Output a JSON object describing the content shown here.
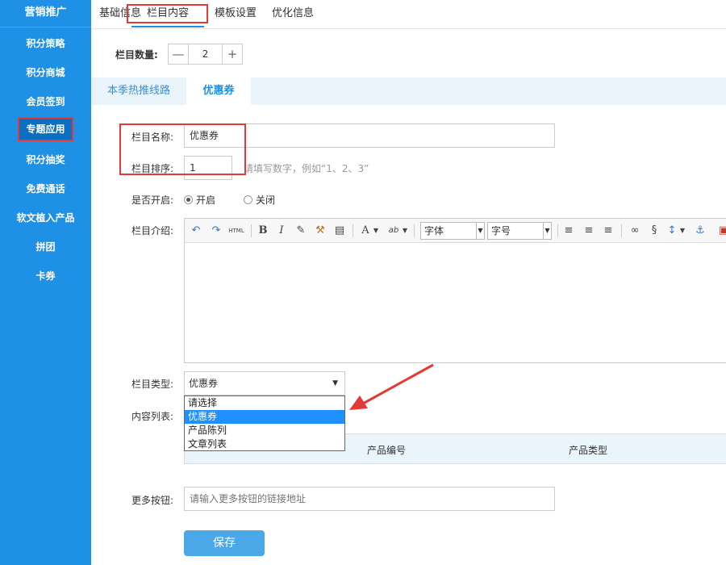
{
  "sidebar": {
    "header": "营销推广",
    "items": [
      {
        "label": "积分策略"
      },
      {
        "label": "积分商城"
      },
      {
        "label": "会员签到"
      },
      {
        "label": "专题应用"
      },
      {
        "label": "积分抽奖"
      },
      {
        "label": "免费通话"
      },
      {
        "label": "软文植入产品"
      },
      {
        "label": "拼团"
      },
      {
        "label": "卡券"
      }
    ],
    "active": "专题应用"
  },
  "tabs": [
    {
      "label": "基础信息"
    },
    {
      "label": "栏目内容"
    },
    {
      "label": "模板设置"
    },
    {
      "label": "优化信息"
    }
  ],
  "column_count": {
    "label": "栏目数量:",
    "minus": "—",
    "value": "2",
    "plus": "+"
  },
  "section_tabs": [
    {
      "label": "本季热推线路"
    },
    {
      "label": "优惠券"
    }
  ],
  "form": {
    "name_label": "栏目名称:",
    "name_value": "优惠券",
    "order_label": "栏目排序:",
    "order_value": "1",
    "order_hint": "请填写数字，例如“1、2、3”",
    "enabled_label": "是否开启:",
    "enabled_on": "开启",
    "enabled_off": "关闭",
    "intro_label": "栏目介绍:",
    "type_label": "栏目类型:",
    "type_value": "优惠券",
    "content_label": "内容列表:",
    "more_label": "更多按钮:",
    "more_placeholder": "请输入更多按钮的链接地址",
    "save": "保存"
  },
  "editor_toolbar": {
    "html": "HTML",
    "bold": "B",
    "italic": "I",
    "font_letter": "A",
    "highlight": "ab",
    "font_family": "字体",
    "font_size": "字号"
  },
  "dropdown_options": [
    "请选择",
    "优惠券",
    "产品陈列",
    "文章列表"
  ],
  "table_headers": {
    "product_no": "产品编号",
    "product_type": "产品类型"
  },
  "colors": {
    "sidebar": "#1E90E6",
    "highlight": "#e53935",
    "save": "#4AA8E8"
  }
}
